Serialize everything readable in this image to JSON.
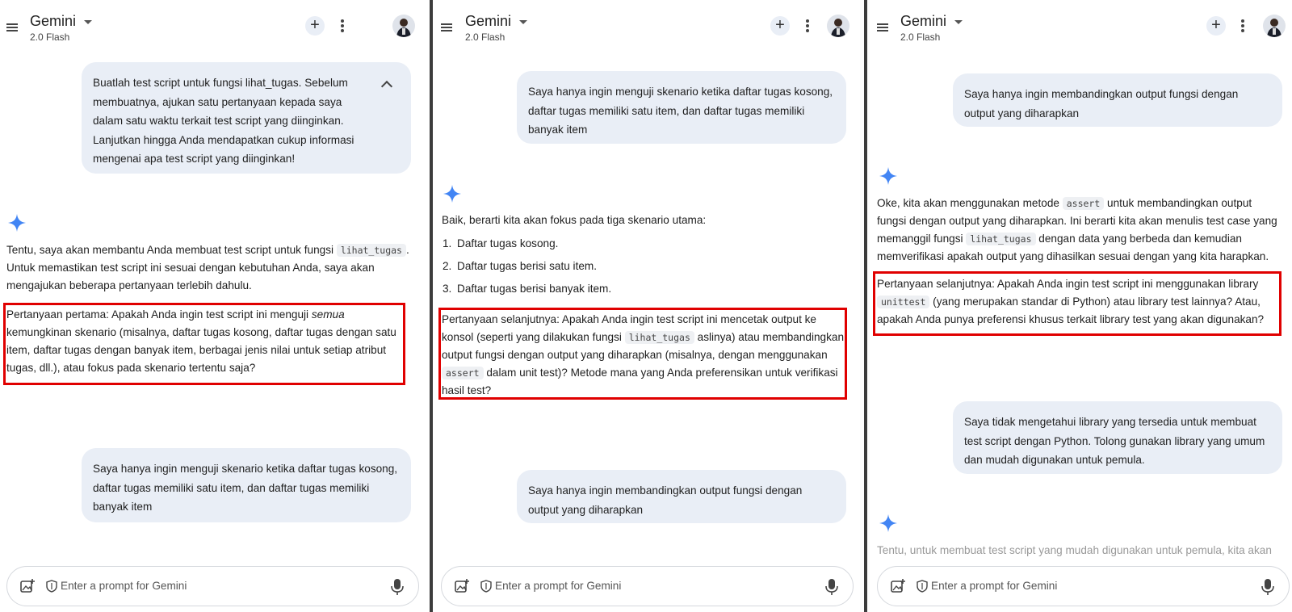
{
  "app": {
    "title": "Gemini",
    "model": "2.0 Flash",
    "prompt_placeholder": "Enter a prompt for Gemini"
  },
  "colors": {
    "user_bubble": "#e9eef6",
    "highlight_border": "#e00000",
    "gemini_star": "#4285f4"
  },
  "icons": [
    "menu-icon",
    "chevron-down-icon",
    "plus-icon",
    "more-vert-icon",
    "avatar",
    "gemini-star-icon",
    "image-add-icon",
    "shield-icon",
    "mic-icon",
    "chevron-up-icon"
  ],
  "panel1": {
    "user_message_1": "Buatlah test script untuk fungsi lihat_tugas. Sebelum membuatnya, ajukan satu pertanyaan kepada saya dalam satu waktu terkait test script yang diinginkan. Lanjutkan hingga Anda mendapatkan cukup informasi mengenai apa test script yang diinginkan!",
    "response_intro_a": "Tentu, saya akan membantu Anda membuat test script untuk fungsi",
    "response_intro_code": "lihat_tugas",
    "response_intro_b": ". Untuk memastikan test script ini sesuai dengan kebutuhan Anda, saya akan mengajukan beberapa pertanyaan terlebih dahulu.",
    "question_a": "Pertanyaan pertama: Apakah Anda ingin test script ini menguji ",
    "question_em": "semua",
    "question_b": " kemungkinan skenario (misalnya, daftar tugas kosong, daftar tugas dengan satu item, daftar tugas dengan banyak item, berbagai jenis nilai untuk setiap atribut tugas, dll.), atau fokus pada skenario tertentu saja?",
    "user_message_2": "Saya hanya ingin menguji skenario ketika daftar tugas kosong, daftar tugas memiliki satu item, dan daftar tugas memiliki banyak item"
  },
  "panel2": {
    "user_message_1": "Saya hanya ingin menguji skenario ketika daftar tugas kosong, daftar tugas memiliki satu item, dan daftar tugas memiliki banyak item",
    "response_intro": "Baik, berarti kita akan fokus pada tiga skenario utama:",
    "list": [
      {
        "n": "1.",
        "text": "Daftar tugas kosong."
      },
      {
        "n": "2.",
        "text": "Daftar tugas berisi satu item."
      },
      {
        "n": "3.",
        "text": "Daftar tugas berisi banyak item."
      }
    ],
    "question_a": "Pertanyaan selanjutnya: Apakah Anda ingin test script ini mencetak output ke konsol (seperti yang dilakukan fungsi ",
    "question_code1": "lihat_tugas",
    "question_b": " aslinya) atau membandingkan output fungsi dengan output yang diharapkan (misalnya, dengan menggunakan ",
    "question_code2": "assert",
    "question_c": " dalam unit test)?  Metode mana yang Anda preferensikan untuk verifikasi hasil test?",
    "user_message_2": "Saya hanya ingin membandingkan output fungsi dengan output yang diharapkan"
  },
  "panel3": {
    "user_message_1": "Saya hanya ingin membandingkan output fungsi dengan output yang diharapkan",
    "response_a": "Oke, kita akan menggunakan metode ",
    "response_code1": "assert",
    "response_b": " untuk membandingkan output fungsi dengan output yang diharapkan. Ini berarti kita akan menulis test case yang memanggil fungsi ",
    "response_code2": "lihat_tugas",
    "response_c": " dengan data yang berbeda dan kemudian memverifikasi apakah output yang dihasilkan sesuai dengan yang kita harapkan.",
    "question_a": "Pertanyaan selanjutnya: Apakah Anda ingin test script ini menggunakan library ",
    "question_code": "unittest",
    "question_b": " (yang merupakan standar di Python) atau library test lainnya? Atau, apakah Anda punya preferensi khusus terkait library test yang akan digunakan?",
    "user_message_2": "Saya tidak mengetahui library yang tersedia untuk membuat test script dengan Python. Tolong gunakan library yang umum dan mudah digunakan untuk pemula.",
    "response_partial": "Tentu, untuk membuat test script yang mudah digunakan untuk pemula, kita akan"
  }
}
